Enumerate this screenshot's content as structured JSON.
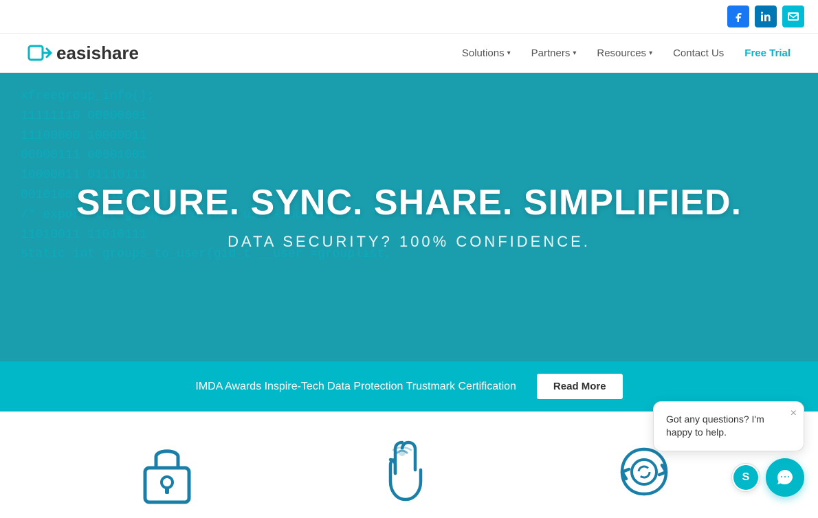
{
  "topbar": {
    "social": [
      {
        "name": "Facebook",
        "icon": "f",
        "class": "social-facebook"
      },
      {
        "name": "LinkedIn",
        "icon": "in",
        "class": "social-linkedin"
      },
      {
        "name": "Email",
        "icon": "✉",
        "class": "social-email"
      }
    ]
  },
  "navbar": {
    "logo_text_light": "easi",
    "logo_text_bold": "share",
    "links": [
      {
        "label": "Solutions",
        "has_dropdown": true
      },
      {
        "label": "Partners",
        "has_dropdown": true
      },
      {
        "label": "Resources",
        "has_dropdown": true
      },
      {
        "label": "Contact Us",
        "has_dropdown": false
      }
    ],
    "cta_label": "Free Trial"
  },
  "hero": {
    "bg_code": "xfreegroup_info();\n11111110 00000001\n11100000 10000011\n00000111 00001001\n10000011 01110111\n00101000 01110011\n/* export the group_info to a user-space array */\n11010011 11010111\nstatic int groups_to_user(gid_t __user =grouplist,",
    "title": "SECURE. SYNC. SHARE. SIMPLIFIED.",
    "subtitle": "DATA SECURITY? 100% CONFIDENCE."
  },
  "banner": {
    "text": "IMDA Awards Inspire-Tech Data Protection Trustmark Certification",
    "button_label": "Read More"
  },
  "features": {
    "items": [
      {
        "name": "security"
      },
      {
        "name": "touch"
      },
      {
        "name": "sync"
      }
    ]
  },
  "chat": {
    "message": "Got any questions? I'm happy to help.",
    "close_label": "×",
    "logo": "S"
  }
}
